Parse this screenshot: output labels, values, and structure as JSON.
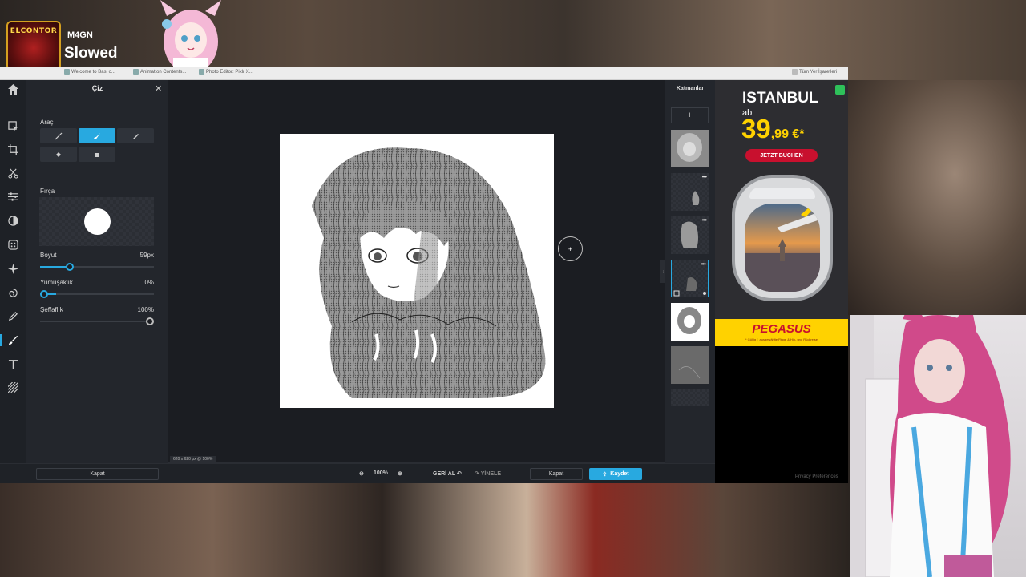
{
  "stream": {
    "logo_text": "ELCONTOR",
    "user": "M4GN",
    "title": "Slowed"
  },
  "browser": {
    "tabs": [
      {
        "label": "Welcome to Basi o..."
      },
      {
        "label": "Animation Contents..."
      },
      {
        "label": "Photo Editor: Pixlr X..."
      }
    ],
    "bookmarks_label": "Tüm Yer İşaretleri"
  },
  "editor": {
    "panel_title": "Çiz",
    "tool_section_label": "Araç",
    "brush_section_label": "Fırça",
    "size_label": "Boyut",
    "size_value": "59px",
    "size_fraction": 0.26,
    "softness_label": "Yumuşaklık",
    "softness_value": "0%",
    "softness_fraction": 0.0,
    "opacity_label": "Şeffaflık",
    "opacity_value": "100%",
    "opacity_fraction": 1.0,
    "canvas_info": "620 x 620 px @ 100%",
    "close_label": "Kapat",
    "zoom_value": "100%",
    "undo_label": "GERİ AL",
    "redo_label": "YİNELE",
    "bottom_close_label": "Kapat",
    "save_label": "Kaydet",
    "layers_title": "Katmanlar",
    "rail_icons": [
      "arrange-icon",
      "crop-icon",
      "cutout-icon",
      "adjust-icon",
      "filter-icon",
      "effect-icon",
      "retouch-icon",
      "liquify-icon",
      "draw-icon",
      "brush-icon",
      "text-icon",
      "pattern-icon"
    ],
    "accent_color": "#28a9e0"
  },
  "ad": {
    "city": "ISTANBUL",
    "ab": "ab",
    "price_main": "39",
    "price_cents": ",99 €*",
    "cta": "JETZT BUCHEN",
    "brand": "PEGASUS",
    "fine_print": "* Gültig f. ausgewählte Flüge & Hin- und Rückreise",
    "privacy": "Privacy Preferences"
  }
}
